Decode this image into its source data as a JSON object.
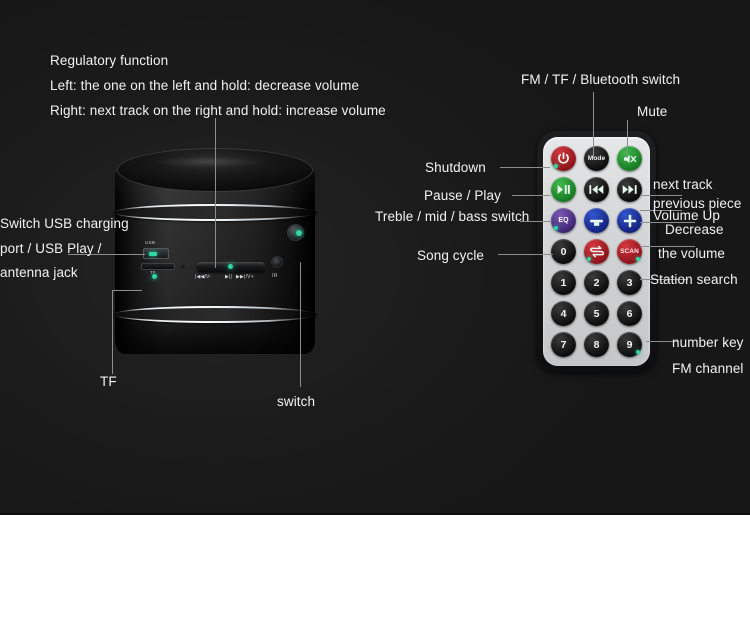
{
  "scene": {
    "background_color": "#1a1a1a",
    "lower_background_color": "#ffffff",
    "accent_led_color": "#2fd6a6",
    "leader_line_color": "#8d8d8d"
  },
  "annotations": {
    "speaker": {
      "regulatory_title": "Regulatory function",
      "regulatory_left": "Left: the one on the left and hold: decrease volume",
      "regulatory_right": "Right: next track on the right and hold: increase volume",
      "usb_line1": "Switch USB charging",
      "usb_line2": "port / USB Play /",
      "usb_line3": "antenna jack",
      "tf": "TF",
      "switch": "switch"
    },
    "remote": {
      "mode": "FM / TF / Bluetooth switch",
      "mute": "Mute",
      "shutdown": "Shutdown",
      "pause_play": "Pause / Play",
      "eq": "Treble / mid / bass switch",
      "song_cycle": "Song cycle",
      "next_track": "next track",
      "previous_piece": "previous piece",
      "volume_up": "Volume Up",
      "decrease": "Decrease",
      "the_volume": "the volume",
      "station_search": "Station search",
      "number_key": "number key",
      "fm_channel": "FM channel"
    }
  },
  "speaker_panel": {
    "usb_cap": "USB",
    "tf_cap": "TF",
    "rocker_cap_prev": "|◀◀/V-",
    "rocker_cap_play": "▶||",
    "rocker_cap_next": "▶▶|/V+",
    "ir_cap": "IR"
  },
  "remote_keys": [
    {
      "name": "power",
      "glyph": "⏻",
      "style": "k-red",
      "kind": "glyph",
      "blip": "left"
    },
    {
      "name": "mode",
      "label": "Mode",
      "style": "k-black",
      "kind": "text"
    },
    {
      "name": "mute",
      "glyph": "🔇",
      "style": "k-green",
      "kind": "mute"
    },
    {
      "name": "play-pause",
      "glyph": "▶❙❙",
      "style": "k-green",
      "kind": "playpause"
    },
    {
      "name": "previous",
      "glyph": "❙◀◀",
      "style": "k-black",
      "kind": "prev"
    },
    {
      "name": "next",
      "glyph": "▶▶❙",
      "style": "k-black",
      "kind": "next"
    },
    {
      "name": "eq",
      "label": "EQ",
      "style": "k-purple",
      "kind": "text",
      "blip": "left"
    },
    {
      "name": "volume-down",
      "glyph": "−",
      "style": "k-blue",
      "kind": "minus"
    },
    {
      "name": "volume-up",
      "glyph": "+",
      "style": "k-blue",
      "kind": "plus"
    },
    {
      "name": "digit-0",
      "label": "0",
      "style": "k-black",
      "kind": "num"
    },
    {
      "name": "song-cycle",
      "glyph": "⇄",
      "style": "k-red",
      "kind": "cycle",
      "blip": "left"
    },
    {
      "name": "scan",
      "label": "SCAN",
      "style": "k-red",
      "kind": "scan",
      "blip": "right"
    },
    {
      "name": "digit-1",
      "label": "1",
      "style": "k-black",
      "kind": "num"
    },
    {
      "name": "digit-2",
      "label": "2",
      "style": "k-black",
      "kind": "num"
    },
    {
      "name": "digit-3",
      "label": "3",
      "style": "k-black",
      "kind": "num"
    },
    {
      "name": "digit-4",
      "label": "4",
      "style": "k-black",
      "kind": "num"
    },
    {
      "name": "digit-5",
      "label": "5",
      "style": "k-black",
      "kind": "num"
    },
    {
      "name": "digit-6",
      "label": "6",
      "style": "k-black",
      "kind": "num"
    },
    {
      "name": "digit-7",
      "label": "7",
      "style": "k-black",
      "kind": "num"
    },
    {
      "name": "digit-8",
      "label": "8",
      "style": "k-black",
      "kind": "num"
    },
    {
      "name": "digit-9",
      "label": "9",
      "style": "k-black",
      "kind": "num",
      "blip": "right"
    }
  ]
}
